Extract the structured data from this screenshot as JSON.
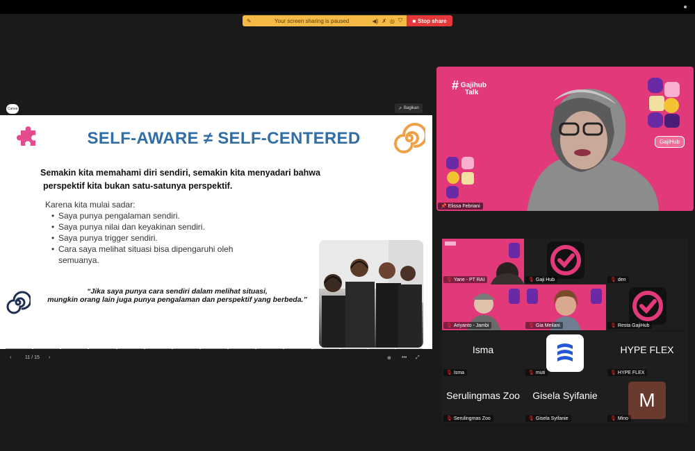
{
  "share_bar": {
    "paused_text": "Your screen sharing is paused",
    "stop_label": "Stop share",
    "accent": "#f5b945",
    "stop_color": "#e5383b"
  },
  "deck": {
    "app_logo": "Canva",
    "share_label": "Bagikan",
    "page_counter": "11 / 15",
    "current_page": 11,
    "total_pages": 15
  },
  "slide": {
    "title": "SELF-AWARE ≠ SELF-CENTERED",
    "title_color": "#2f6ea6",
    "lead_line1": "Semakin kita memahami diri sendiri, semakin kita menyadari bahwa",
    "lead_line2": "perspektif kita bukan satu-satunya perspektif.",
    "reason_intro": "Karena kita mulai sadar:",
    "bullets": [
      "Saya punya pengalaman sendiri.",
      "Saya punya nilai dan keyakinan sendiri.",
      "Saya punya trigger sendiri.",
      "Cara saya melihat situasi bisa dipengaruhi oleh semuanya."
    ],
    "quote_line1": "“Jika saya punya cara sendiri dalam melihat situasi,",
    "quote_line2": "mungkin orang lain juga punya pengalaman dan perspektif yang berbeda.”"
  },
  "speaker": {
    "brand_line1": "Gajihub",
    "brand_line2": "Talk",
    "tag": "GajiHub",
    "name": "Elissa Febriani",
    "bg": "#e2397a"
  },
  "participants": [
    {
      "name": "Yane - PT RAI"
    },
    {
      "name": "Gaji Hub"
    },
    {
      "name": "den"
    },
    {
      "name": "Ariyanto - Jambi"
    },
    {
      "name": "Gia Meilani"
    },
    {
      "name": "Resta GajiHub"
    },
    {
      "name": "Isma",
      "display": "Isma"
    },
    {
      "name": "muti"
    },
    {
      "name": "HYPE FLEX",
      "display": "HYPE FLEX"
    },
    {
      "name": "Serulingmas Zoo",
      "display": "Serulingmas Zoo"
    },
    {
      "name": "Gisela Syifanie",
      "display": "Gisela Syifanie"
    },
    {
      "name": "Mino",
      "initial": "M"
    }
  ]
}
